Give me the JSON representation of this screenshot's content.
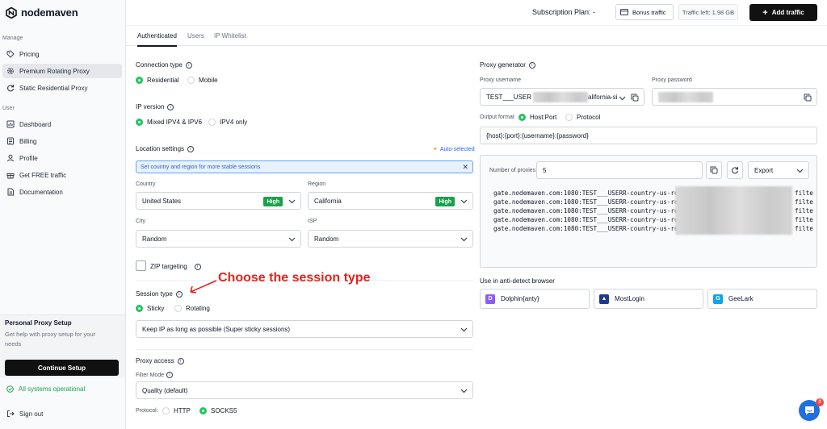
{
  "brand": {
    "name": "nodemaven"
  },
  "sidebar": {
    "manage_label": "Manage",
    "manage_items": [
      {
        "label": "Pricing",
        "icon": "pricing-icon"
      },
      {
        "label": "Premium Rotating Proxy",
        "icon": "gear-icon",
        "active": true
      },
      {
        "label": "Static Residential Proxy",
        "icon": "refresh-icon"
      }
    ],
    "user_label": "User",
    "user_items": [
      {
        "label": "Dashboard",
        "icon": "dashboard-icon"
      },
      {
        "label": "Billing",
        "icon": "billing-icon"
      },
      {
        "label": "Profile",
        "icon": "profile-icon"
      },
      {
        "label": "Get FREE traffic",
        "icon": "gift-icon"
      },
      {
        "label": "Documentation",
        "icon": "document-icon"
      }
    ],
    "setup": {
      "title": "Personal Proxy Setup",
      "description": "Get help with proxy setup for your needs",
      "button": "Continue Setup"
    },
    "status": "All systems operational",
    "signout": "Sign out"
  },
  "header": {
    "subscription_plan": "Subscription Plan: -",
    "bonus_traffic": "Bonus traffic",
    "traffic_left": "Traffic left: 1.98 GB",
    "add_traffic": "Add traffic"
  },
  "tabs": [
    "Authenticated",
    "Users",
    "IP Whitelist"
  ],
  "left": {
    "connection_type": {
      "label": "Connection type",
      "options": [
        "Residential",
        "Mobile"
      ],
      "selected": 0
    },
    "ip_version": {
      "label": "IP version",
      "options": [
        "Mixed IPV4 & IPV6",
        "IPV4 only"
      ],
      "selected": 0
    },
    "location": {
      "label": "Location settings",
      "auto_selected": "Auto-selected",
      "hint": "Set country and region for more stable sessions",
      "country_label": "Country",
      "country_value": "United States",
      "country_badge": "High",
      "region_label": "Region",
      "region_value": "California",
      "region_badge": "High",
      "city_label": "City",
      "city_value": "Random",
      "isp_label": "ISP",
      "isp_value": "Random"
    },
    "zip_targeting": "ZIP targeting",
    "session_type": {
      "label": "Session type",
      "options": [
        "Sticky",
        "Rotating"
      ],
      "selected": 0,
      "dropdown_value": "Keep IP as long as possible (Super sticky sessions)"
    },
    "proxy_access": {
      "label": "Proxy access",
      "filter_mode_label": "Filter Mode",
      "filter_mode_value": "Quality (default)",
      "protocol_label": "Protocol:",
      "protocols": [
        "HTTP",
        "SOCKS5"
      ],
      "selected": 1
    }
  },
  "annotation": "Choose the session type",
  "right": {
    "title": "Proxy generator",
    "username_label": "Proxy username",
    "username_prefix": "TEST___USER",
    "username_suffix": "alifornia-si",
    "password_label": "Proxy password",
    "output_format_label": "Output format",
    "output_formats": [
      "Host:Port",
      "Protocol"
    ],
    "output_selected": 0,
    "format_string": "{host}:{port}:{username}:{password}",
    "num_proxies_label": "Number of proxies",
    "num_proxies_value": "5",
    "export_label": "Export",
    "proxy_lines": [
      {
        "prefix": "gate.nodemaven.com:1080:TEST___USERR-country-us-reg",
        "suffix": "filte"
      },
      {
        "prefix": "gate.nodemaven.com:1080:TEST___USERR-country-us-reg",
        "suffix": "filte"
      },
      {
        "prefix": "gate.nodemaven.com:1080:TEST___USERR-country-us-reg",
        "suffix": "filte"
      },
      {
        "prefix": "gate.nodemaven.com:1080:TEST___USERR-country-us-reg",
        "suffix": "filte"
      },
      {
        "prefix": "gate.nodemaven.com:1080:TEST___USERR-country-us-reg",
        "suffix": "filte"
      }
    ],
    "anti_detect_label": "Use in anti-detect browser",
    "browsers": [
      "Dolphin{anty}",
      "MostLogin",
      "GeeLark"
    ]
  },
  "chat_badge": "2",
  "colors": {
    "accent_green": "#22c55e",
    "annotation_red": "#e5231b",
    "primary_dark": "#111111",
    "chat_blue": "#1e6fe0"
  }
}
